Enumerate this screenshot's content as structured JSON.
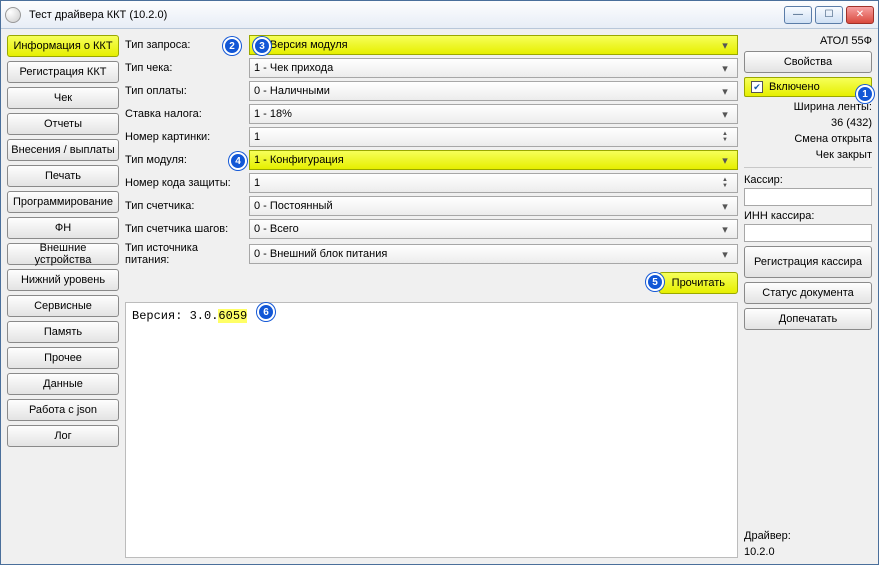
{
  "window": {
    "title": "Тест драйвера ККТ (10.2.0)"
  },
  "sidebar": {
    "items": [
      "Информация о ККТ",
      "Регистрация ККТ",
      "Чек",
      "Отчеты",
      "Внесения / выплаты",
      "Печать",
      "Программирование",
      "ФН",
      "Внешние устройства",
      "Нижний уровень",
      "Сервисные",
      "Память",
      "Прочее",
      "Данные",
      "Работа с json",
      "Лог"
    ],
    "active_index": 0
  },
  "form": {
    "tip_zaprosa_label": "Тип запроса:",
    "tip_zaprosa_value": "2 - Версия модуля",
    "tip_cheka_label": "Тип чека:",
    "tip_cheka_value": "1 - Чек прихода",
    "tip_oplaty_label": "Тип оплаты:",
    "tip_oplaty_value": "0 - Наличными",
    "stavka_naloga_label": "Ставка налога:",
    "stavka_naloga_value": "1 - 18%",
    "nomer_kartinki_label": "Номер картинки:",
    "nomer_kartinki_value": "1",
    "tip_modulya_label": "Тип модуля:",
    "tip_modulya_value": "1 - Конфигурация",
    "nomer_koda_label": "Номер кода защиты:",
    "nomer_koda_value": "1",
    "tip_schetchika_label": "Тип счетчика:",
    "tip_schetchika_value": "0 - Постоянный",
    "tip_schetchika_shagov_label": "Тип счетчика шагов:",
    "tip_schetchika_shagov_value": "0 - Всего",
    "tip_istochnika_label": "Тип источника питания:",
    "tip_istochnika_value": "0 - Внешний блок питания",
    "read_btn": "Прочитать"
  },
  "output": {
    "prefix": "Версия: 3.0.",
    "highlight": "6059"
  },
  "right": {
    "device": "АТОЛ 55Ф",
    "props_btn": "Свойства",
    "enabled_label": "Включено",
    "tape_width_label": "Ширина ленты:",
    "tape_width_value": "36 (432)",
    "shift_status": "Смена открыта",
    "cheque_status": "Чек закрыт",
    "kassir_label": "Кассир:",
    "inn_label": "ИНН кассира:",
    "reg_kassir_btn": "Регистрация кассира",
    "doc_status_btn": "Статус документа",
    "print_more_btn": "Допечатать",
    "driver_label": "Драйвер:",
    "driver_version": "10.2.0"
  },
  "badges": [
    "1",
    "2",
    "3",
    "4",
    "5",
    "6"
  ]
}
